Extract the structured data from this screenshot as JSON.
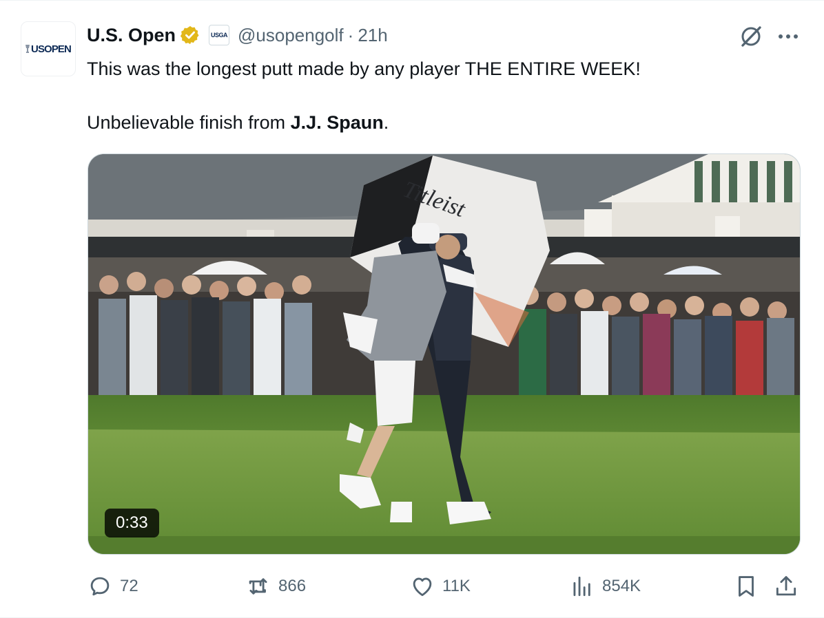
{
  "tweet": {
    "author": {
      "display_name": "U.S. Open",
      "handle": "@usopengolf",
      "affiliation_badge": "USGA",
      "avatar_logo": "USOPEN",
      "verified_color": "#e2b719"
    },
    "separator": "·",
    "timestamp": "21h",
    "text_line1": "This was the longest putt made by any player THE ENTIRE WEEK!",
    "text_line2_prefix": "Unbelievable finish from ",
    "text_line2_bold": "J.J. Spaun",
    "text_line2_suffix": ".",
    "media": {
      "duration": "0:33"
    },
    "stats": {
      "replies": "72",
      "reposts": "866",
      "likes": "11K",
      "views": "854K"
    },
    "icons": {
      "grok": "grok-icon",
      "more": "more-icon",
      "reply": "reply-icon",
      "repost": "repost-icon",
      "like": "like-icon",
      "views": "views-icon",
      "bookmark": "bookmark-icon",
      "share": "share-icon"
    },
    "colors": {
      "text_primary": "#0f1419",
      "text_secondary": "#536471"
    }
  }
}
